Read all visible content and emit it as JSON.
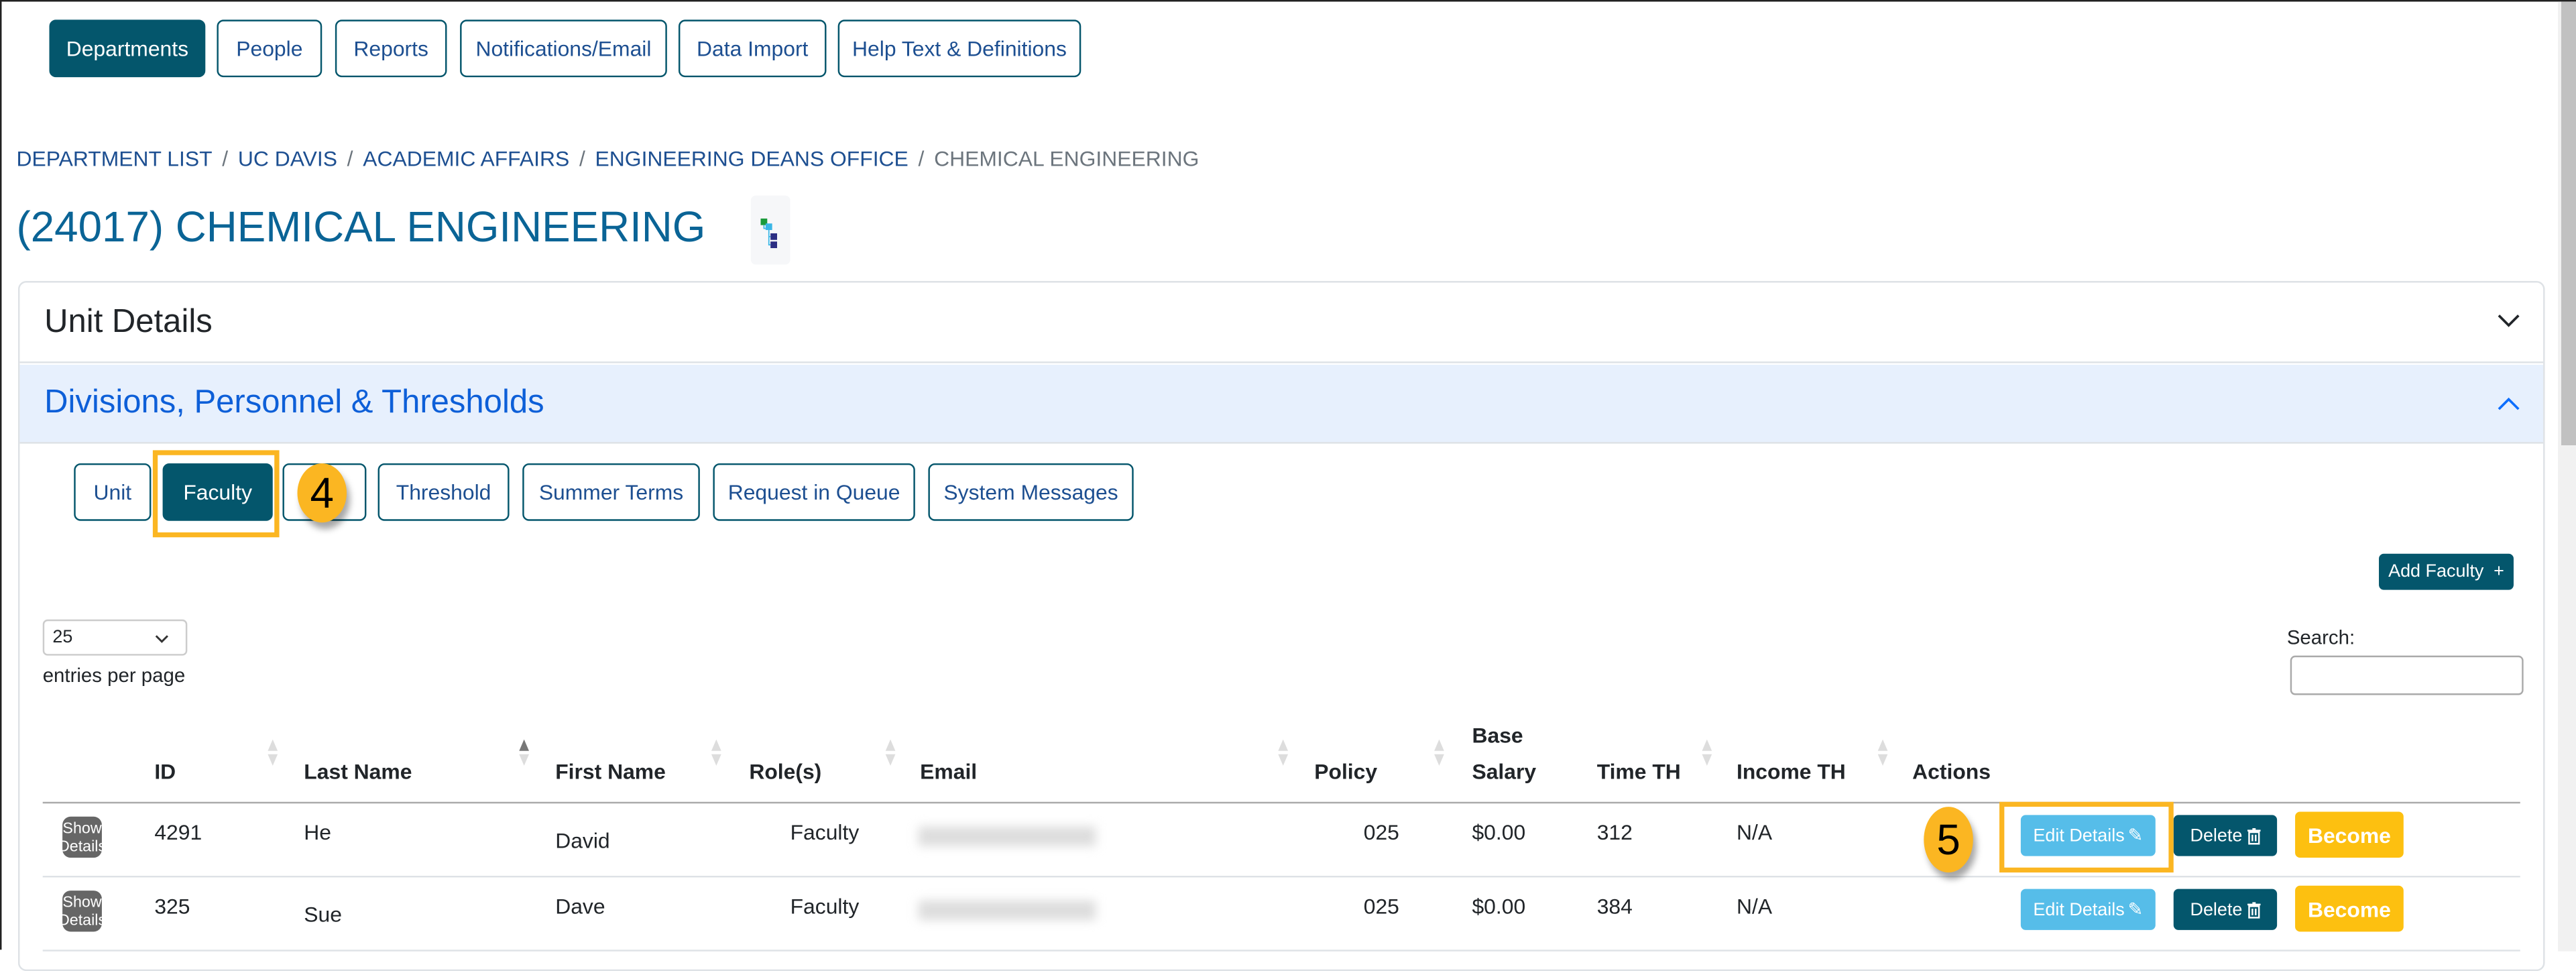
{
  "nav": {
    "items": [
      "Departments",
      "People",
      "Reports",
      "Notifications/Email",
      "Data Import",
      "Help Text & Definitions"
    ],
    "active": "Departments"
  },
  "breadcrumb": [
    "DEPARTMENT LIST",
    "UC DAVIS",
    "ACADEMIC AFFAIRS",
    "ENGINEERING DEANS OFFICE",
    "CHEMICAL ENGINEERING"
  ],
  "page_title": "(24017) CHEMICAL ENGINEERING",
  "title_icon": "hierarchy-tree-icon",
  "accordion": {
    "unit_details": "Unit Details",
    "divisions": "Divisions, Personnel & Thresholds"
  },
  "subtabs": {
    "items": [
      "Unit",
      "Faculty",
      "",
      "Threshold",
      "Summer Terms",
      "Request in Queue",
      "System Messages"
    ],
    "active": "Faculty"
  },
  "callouts": {
    "step4": "4",
    "step5": "5"
  },
  "add_faculty": "Add Faculty",
  "add_icon": "+",
  "entries": {
    "value": "25",
    "label": "entries per page"
  },
  "search": {
    "label": "Search:",
    "value": ""
  },
  "table": {
    "headers": {
      "id": "ID",
      "last": "Last Name",
      "first": "First Name",
      "roles": "Role(s)",
      "email": "Email",
      "policy": "Policy",
      "base1": "Base",
      "base2": "Salary",
      "time": "Time TH",
      "income": "Income TH",
      "actions": "Actions"
    },
    "sorted_column": "Last Name",
    "sort_direction": "ascending",
    "rows": [
      {
        "show": "Show Details",
        "id": "4291",
        "last": "He",
        "first": "David",
        "roles": "Faculty",
        "policy": "025",
        "base": "$0.00",
        "time": "312",
        "income": "N/A",
        "edit": "Edit Details",
        "delete": "Delete",
        "become": "Become"
      },
      {
        "show": "Show Details",
        "id": "325",
        "last": "Sue",
        "first": "Dave",
        "roles": "Faculty",
        "policy": "025",
        "base": "$0.00",
        "time": "384",
        "income": "N/A",
        "edit": "Edit Details",
        "delete": "Delete",
        "become": "Become"
      }
    ]
  },
  "colors": {
    "primary": "#04566c",
    "highlight": "#fbb622",
    "edit": "#56bde9",
    "become": "#fdc010",
    "accordion_active_bg": "#e7f0fd"
  }
}
